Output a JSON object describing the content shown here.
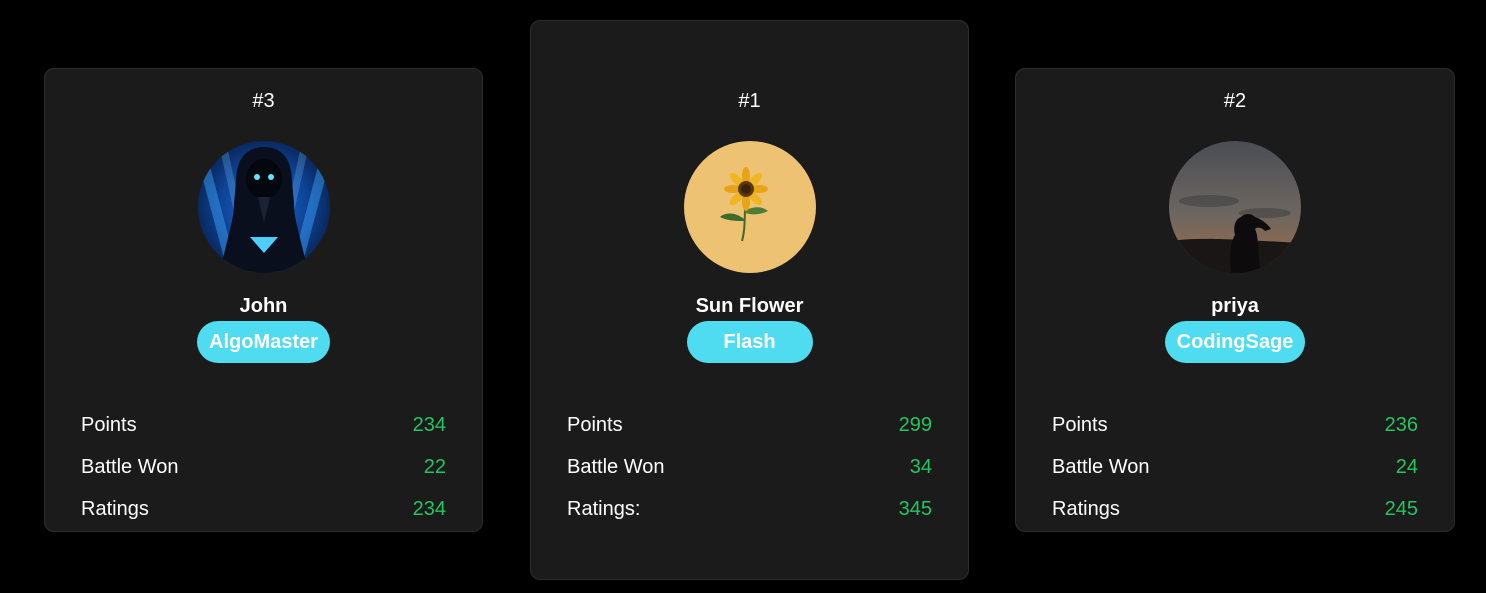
{
  "cards": [
    {
      "rank": "#3",
      "name": "John",
      "title": "AlgoMaster",
      "avatar_icon": "hooded-figure-avatar",
      "stats": [
        {
          "label": "Points",
          "value": "234"
        },
        {
          "label": "Battle Won",
          "value": "22"
        },
        {
          "label": "Ratings",
          "value": "234"
        }
      ]
    },
    {
      "rank": "#1",
      "name": "Sun Flower",
      "title": "Flash",
      "avatar_icon": "sunflower-avatar",
      "stats": [
        {
          "label": "Points",
          "value": "299"
        },
        {
          "label": "Battle Won",
          "value": "34"
        },
        {
          "label": "Ratings:",
          "value": "345"
        }
      ]
    },
    {
      "rank": "#2",
      "name": "priya",
      "title": "CodingSage",
      "avatar_icon": "silhouette-sunset-avatar",
      "stats": [
        {
          "label": "Points",
          "value": "236"
        },
        {
          "label": "Battle Won",
          "value": "24"
        },
        {
          "label": "Ratings",
          "value": "245"
        }
      ]
    }
  ],
  "colors": {
    "background": "#000000",
    "card": "#1b1b1b",
    "badge": "#4fdcf0",
    "stat_value": "#22c55e"
  }
}
